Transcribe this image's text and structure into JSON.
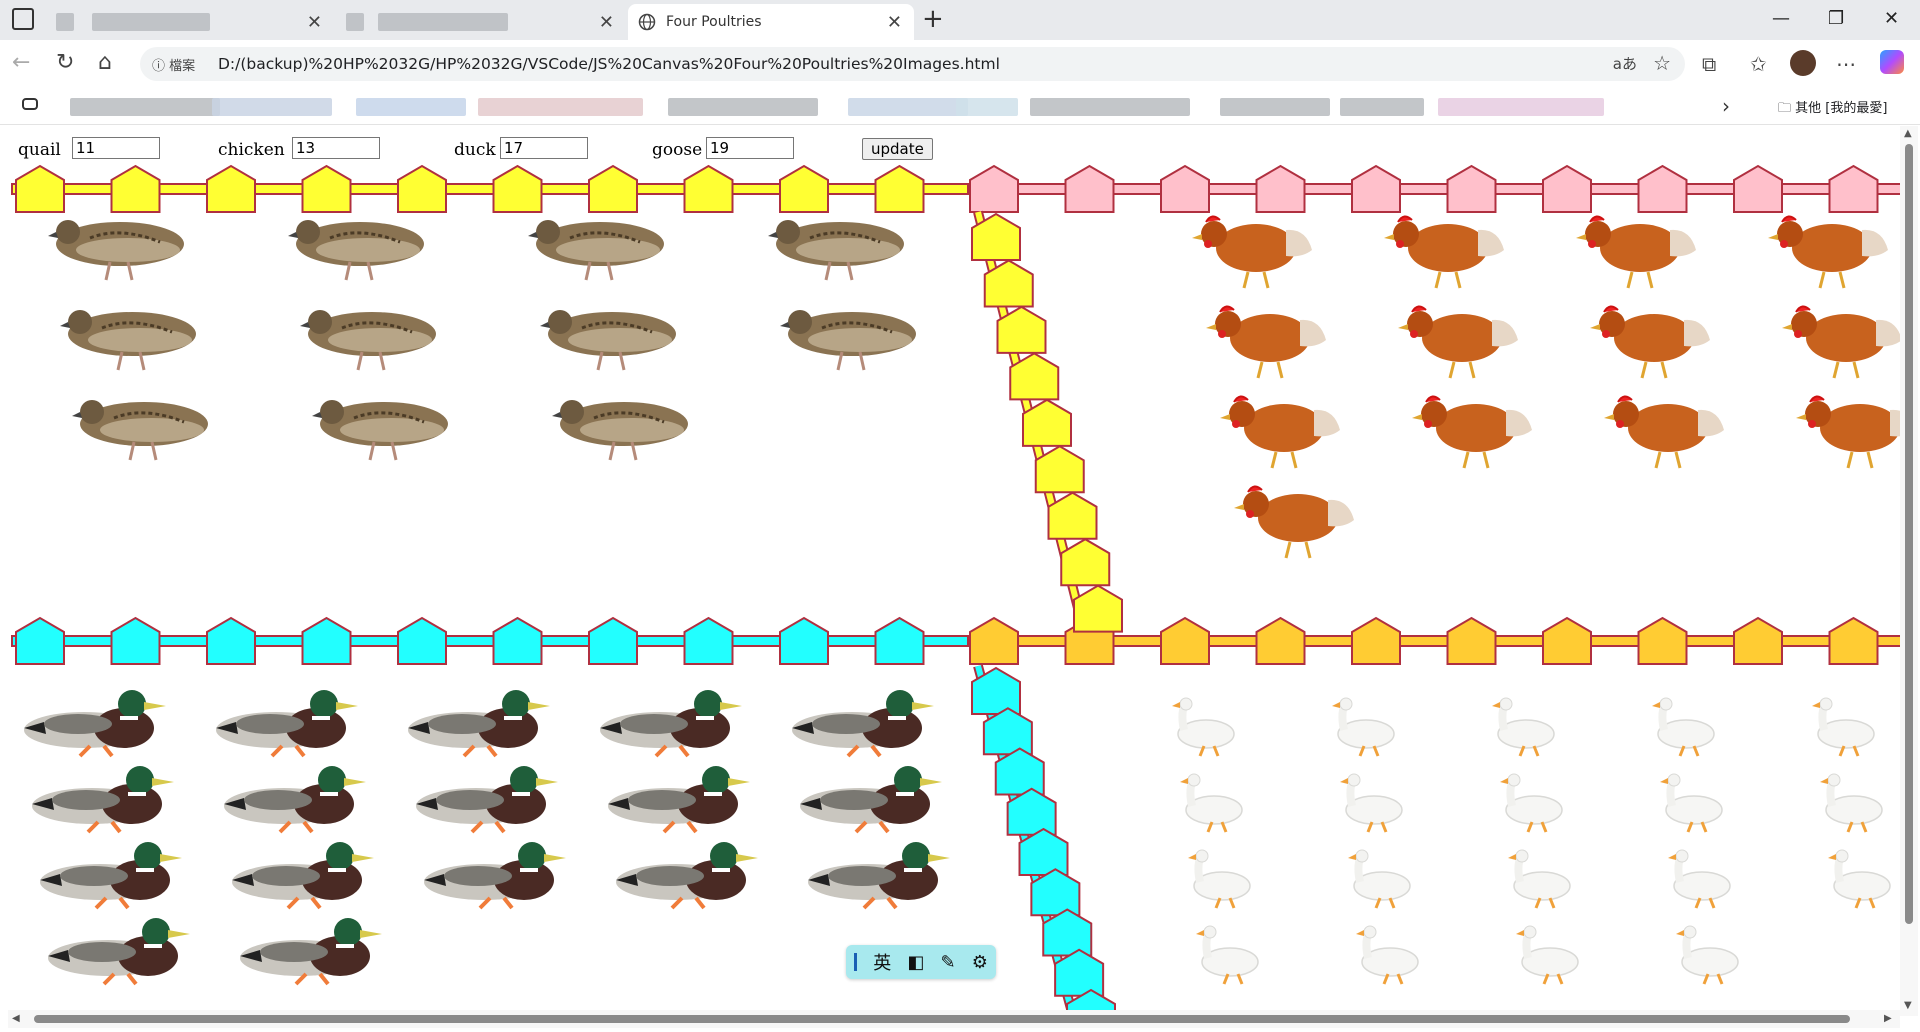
{
  "browser": {
    "tabs": [
      {
        "title": ""
      },
      {
        "title": ""
      },
      {
        "title": "Four Poultries"
      }
    ],
    "address": {
      "badge": "檔案",
      "url": "D:/(backup)%20HP%2032G/HP%2032G/VSCode/JS%20Canvas%20Four%20Poultries%20Images.html",
      "translate": "aあ"
    },
    "bookmarks": {
      "folder_label": "其他 [我的最愛]"
    }
  },
  "controls": {
    "quail_label": "quail",
    "quail_value": "11",
    "chicken_label": "chicken",
    "chicken_value": "13",
    "duck_label": "duck",
    "duck_value": "17",
    "goose_label": "goose",
    "goose_value": "19",
    "update_label": "update"
  },
  "counts": {
    "quail": 11,
    "chicken": 13,
    "duck": 17,
    "goose": 19
  },
  "colors": {
    "quail_fence": "#ffff33",
    "chicken_fence": "#ffc0cb",
    "duck_fence": "#22ffff",
    "goose_fence": "#ffcc33",
    "fence_stroke": "#b03040"
  },
  "ime": {
    "mode": "英"
  }
}
